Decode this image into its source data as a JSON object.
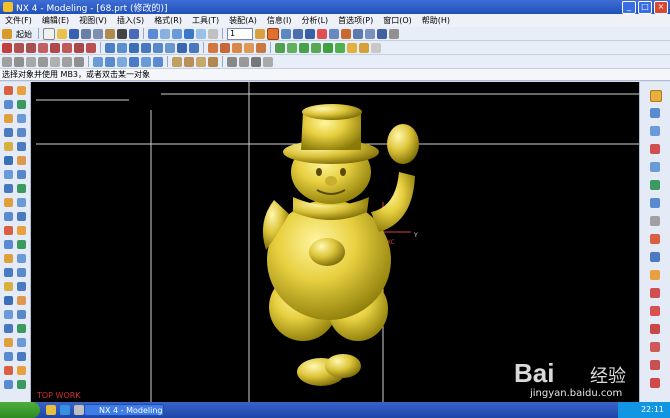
{
  "window": {
    "title": "NX 4 - Modeling - [68.prt (修改的)]"
  },
  "menubar": {
    "items": [
      "文件(F)",
      "编辑(E)",
      "视图(V)",
      "插入(S)",
      "格式(R)",
      "工具(T)",
      "装配(A)",
      "信息(I)",
      "分析(L)",
      "首选项(P)",
      "窗口(O)",
      "帮助(H)"
    ]
  },
  "toolbar": {
    "start_label": "起始",
    "layer_value": "1"
  },
  "cue_line": "选择对象并使用 MB3，或者双击某一对象",
  "viewport": {
    "watermark": "TOP WORK",
    "axis_label": "XC"
  },
  "taskbar": {
    "task_label": "NX 4 - Modeling - [...]",
    "clock": "22:11"
  },
  "watermark": {
    "logo": "Bai",
    "brand": "经验",
    "url": "jingyan.baidu.com"
  }
}
